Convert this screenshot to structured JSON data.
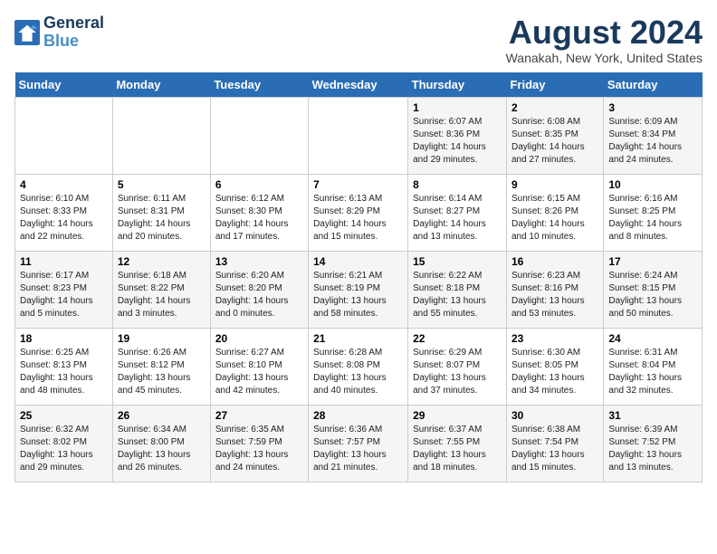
{
  "header": {
    "logo_line1": "General",
    "logo_line2": "Blue",
    "month_title": "August 2024",
    "location": "Wanakah, New York, United States"
  },
  "days_of_week": [
    "Sunday",
    "Monday",
    "Tuesday",
    "Wednesday",
    "Thursday",
    "Friday",
    "Saturday"
  ],
  "weeks": [
    [
      {
        "day": "",
        "info": ""
      },
      {
        "day": "",
        "info": ""
      },
      {
        "day": "",
        "info": ""
      },
      {
        "day": "",
        "info": ""
      },
      {
        "day": "1",
        "info": "Sunrise: 6:07 AM\nSunset: 8:36 PM\nDaylight: 14 hours\nand 29 minutes."
      },
      {
        "day": "2",
        "info": "Sunrise: 6:08 AM\nSunset: 8:35 PM\nDaylight: 14 hours\nand 27 minutes."
      },
      {
        "day": "3",
        "info": "Sunrise: 6:09 AM\nSunset: 8:34 PM\nDaylight: 14 hours\nand 24 minutes."
      }
    ],
    [
      {
        "day": "4",
        "info": "Sunrise: 6:10 AM\nSunset: 8:33 PM\nDaylight: 14 hours\nand 22 minutes."
      },
      {
        "day": "5",
        "info": "Sunrise: 6:11 AM\nSunset: 8:31 PM\nDaylight: 14 hours\nand 20 minutes."
      },
      {
        "day": "6",
        "info": "Sunrise: 6:12 AM\nSunset: 8:30 PM\nDaylight: 14 hours\nand 17 minutes."
      },
      {
        "day": "7",
        "info": "Sunrise: 6:13 AM\nSunset: 8:29 PM\nDaylight: 14 hours\nand 15 minutes."
      },
      {
        "day": "8",
        "info": "Sunrise: 6:14 AM\nSunset: 8:27 PM\nDaylight: 14 hours\nand 13 minutes."
      },
      {
        "day": "9",
        "info": "Sunrise: 6:15 AM\nSunset: 8:26 PM\nDaylight: 14 hours\nand 10 minutes."
      },
      {
        "day": "10",
        "info": "Sunrise: 6:16 AM\nSunset: 8:25 PM\nDaylight: 14 hours\nand 8 minutes."
      }
    ],
    [
      {
        "day": "11",
        "info": "Sunrise: 6:17 AM\nSunset: 8:23 PM\nDaylight: 14 hours\nand 5 minutes."
      },
      {
        "day": "12",
        "info": "Sunrise: 6:18 AM\nSunset: 8:22 PM\nDaylight: 14 hours\nand 3 minutes."
      },
      {
        "day": "13",
        "info": "Sunrise: 6:20 AM\nSunset: 8:20 PM\nDaylight: 14 hours\nand 0 minutes."
      },
      {
        "day": "14",
        "info": "Sunrise: 6:21 AM\nSunset: 8:19 PM\nDaylight: 13 hours\nand 58 minutes."
      },
      {
        "day": "15",
        "info": "Sunrise: 6:22 AM\nSunset: 8:18 PM\nDaylight: 13 hours\nand 55 minutes."
      },
      {
        "day": "16",
        "info": "Sunrise: 6:23 AM\nSunset: 8:16 PM\nDaylight: 13 hours\nand 53 minutes."
      },
      {
        "day": "17",
        "info": "Sunrise: 6:24 AM\nSunset: 8:15 PM\nDaylight: 13 hours\nand 50 minutes."
      }
    ],
    [
      {
        "day": "18",
        "info": "Sunrise: 6:25 AM\nSunset: 8:13 PM\nDaylight: 13 hours\nand 48 minutes."
      },
      {
        "day": "19",
        "info": "Sunrise: 6:26 AM\nSunset: 8:12 PM\nDaylight: 13 hours\nand 45 minutes."
      },
      {
        "day": "20",
        "info": "Sunrise: 6:27 AM\nSunset: 8:10 PM\nDaylight: 13 hours\nand 42 minutes."
      },
      {
        "day": "21",
        "info": "Sunrise: 6:28 AM\nSunset: 8:08 PM\nDaylight: 13 hours\nand 40 minutes."
      },
      {
        "day": "22",
        "info": "Sunrise: 6:29 AM\nSunset: 8:07 PM\nDaylight: 13 hours\nand 37 minutes."
      },
      {
        "day": "23",
        "info": "Sunrise: 6:30 AM\nSunset: 8:05 PM\nDaylight: 13 hours\nand 34 minutes."
      },
      {
        "day": "24",
        "info": "Sunrise: 6:31 AM\nSunset: 8:04 PM\nDaylight: 13 hours\nand 32 minutes."
      }
    ],
    [
      {
        "day": "25",
        "info": "Sunrise: 6:32 AM\nSunset: 8:02 PM\nDaylight: 13 hours\nand 29 minutes."
      },
      {
        "day": "26",
        "info": "Sunrise: 6:34 AM\nSunset: 8:00 PM\nDaylight: 13 hours\nand 26 minutes."
      },
      {
        "day": "27",
        "info": "Sunrise: 6:35 AM\nSunset: 7:59 PM\nDaylight: 13 hours\nand 24 minutes."
      },
      {
        "day": "28",
        "info": "Sunrise: 6:36 AM\nSunset: 7:57 PM\nDaylight: 13 hours\nand 21 minutes."
      },
      {
        "day": "29",
        "info": "Sunrise: 6:37 AM\nSunset: 7:55 PM\nDaylight: 13 hours\nand 18 minutes."
      },
      {
        "day": "30",
        "info": "Sunrise: 6:38 AM\nSunset: 7:54 PM\nDaylight: 13 hours\nand 15 minutes."
      },
      {
        "day": "31",
        "info": "Sunrise: 6:39 AM\nSunset: 7:52 PM\nDaylight: 13 hours\nand 13 minutes."
      }
    ]
  ]
}
